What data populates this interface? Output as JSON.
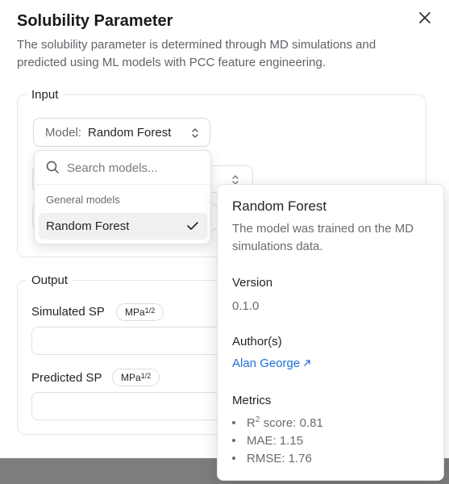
{
  "dialog": {
    "title": "Solubility Parameter",
    "description": "The solubility parameter is determined through MD simulations and predicted using ML models with PCC feature engineering."
  },
  "input_section": {
    "legend": "Input",
    "model_select": {
      "label": "Model:",
      "value": "Random Forest"
    }
  },
  "model_dropdown": {
    "search_placeholder": "Search models...",
    "group_label": "General models",
    "options": [
      {
        "label": "Random Forest",
        "selected": true
      }
    ]
  },
  "output_section": {
    "legend": "Output",
    "simulated": {
      "label": "Simulated SP",
      "unit": "MPa",
      "unit_exp": "1/2"
    },
    "predicted": {
      "label": "Predicted SP",
      "unit": "MPa",
      "unit_exp": "1/2"
    }
  },
  "model_info": {
    "title": "Random Forest",
    "description": "The model was trained on the MD simulations data.",
    "version_label": "Version",
    "version": "0.1.0",
    "authors_label": "Author(s)",
    "author": "Alan George",
    "metrics_label": "Metrics",
    "metrics": [
      {
        "name": "R",
        "exp": "2",
        "rest": " score: 0.81"
      },
      {
        "name": "MAE: 1.15",
        "exp": "",
        "rest": ""
      },
      {
        "name": "RMSE: 1.76",
        "exp": "",
        "rest": ""
      }
    ]
  },
  "colors": {
    "overlay": "#7d7d7d",
    "link": "#1f6fd8",
    "muted_text": "#6b6b6b",
    "selected_option_bg": "#f1f1f1"
  },
  "icons": [
    "close-icon",
    "chevron-updown-icon",
    "search-icon",
    "check-icon",
    "external-link-icon"
  ]
}
